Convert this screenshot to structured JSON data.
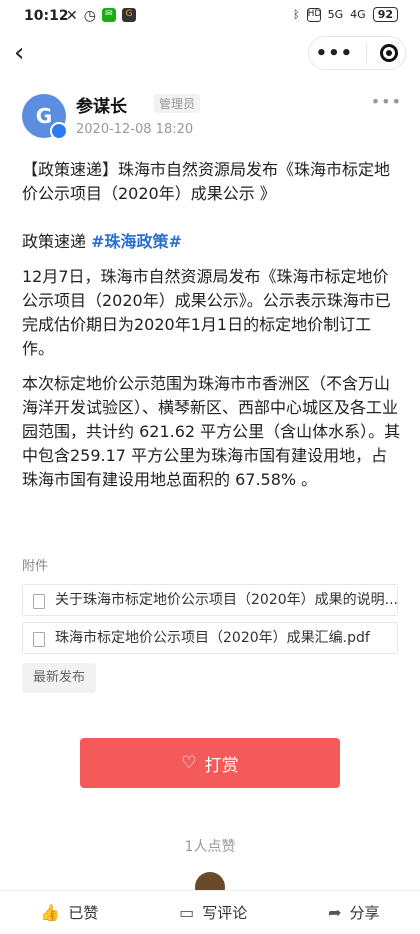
{
  "status": {
    "time": "10:12",
    "network": "5G",
    "network2": "4G",
    "battery": "92"
  },
  "author": {
    "name": "参谋长",
    "badge": "管理员",
    "date": "2020-12-08 18:20",
    "avatar_letter": "G"
  },
  "content": {
    "title": "【政策速递】珠海市自然资源局发布《珠海市标定地价公示项目（2020年）成果公示 》",
    "tag_prefix": "政策速递 ",
    "tag": "#珠海政策#",
    "para1": "12月7日，珠海市自然资源局发布《珠海市标定地价公示项目（2020年）成果公示》。公示表示珠海市已完成估价期日为2020年1月1日的标定地价制订工作。",
    "para2": "本次标定地价公示范围为珠海市市香洲区（不含万山海洋开发试验区）、横琴新区、西部中心城区及各工业园范围，共计约 621.62 平方公里（含山体水系）。其中包含259.17 平方公里为珠海市国有建设用地，占珠海市国有建设用地总面积的 67.58% 。"
  },
  "attachments": {
    "label": "附件",
    "items": [
      "关于珠海市标定地价公示项目（2020年）成果的说明...",
      "珠海市标定地价公示项目（2020年）成果汇编.pdf"
    ]
  },
  "latest_label": "最新发布",
  "tip_label": "打赏",
  "likes_text": "1人点赞",
  "bottombar": {
    "like": "已赞",
    "comment": "写评论",
    "share": "分享"
  }
}
